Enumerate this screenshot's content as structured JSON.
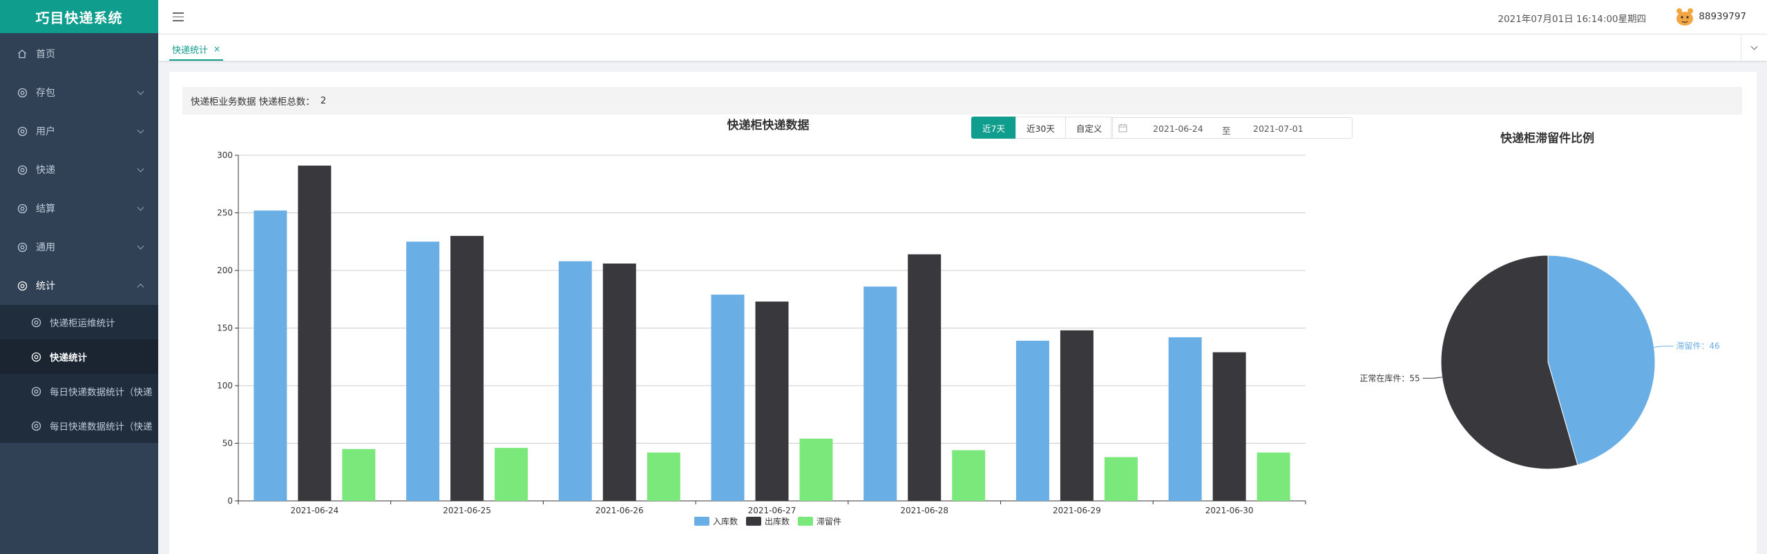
{
  "app": {
    "title": "巧目快递系统"
  },
  "sidebar": {
    "items": [
      {
        "label": "首页",
        "icon": "home-icon",
        "has_children": false
      },
      {
        "label": "存包",
        "icon": "gear-icon",
        "has_children": true
      },
      {
        "label": "用户",
        "icon": "gear-icon",
        "has_children": true
      },
      {
        "label": "快递",
        "icon": "gear-icon",
        "has_children": true
      },
      {
        "label": "结算",
        "icon": "gear-icon",
        "has_children": true
      },
      {
        "label": "通用",
        "icon": "gear-icon",
        "has_children": true
      },
      {
        "label": "统计",
        "icon": "gear-icon",
        "has_children": true,
        "open": true
      }
    ],
    "submenu": [
      {
        "label": "快递柜运维统计",
        "active": false
      },
      {
        "label": "快递统计",
        "active": true
      },
      {
        "label": "每日快递数据统计（快递",
        "active": false
      },
      {
        "label": "每日快递数据统计（快递",
        "active": false
      }
    ]
  },
  "header": {
    "datetime": "2021年07月01日 16:14:00星期四",
    "username": "88939797"
  },
  "tabs": [
    {
      "label": "快递统计",
      "close": "×"
    }
  ],
  "info": {
    "text": "快递柜业务数据 快递柜总数：",
    "count": "2"
  },
  "filters": {
    "buttons": [
      "近7天",
      "近30天",
      "自定义"
    ],
    "active_index": 0,
    "start_date": "2021-06-24",
    "separator": "至",
    "end_date": "2021-07-01"
  },
  "colors": {
    "accent": "#0f9d8e",
    "inbound": "#6aaee6",
    "outbound": "#39393d",
    "retained": "#7be87c",
    "sidebar_bg": "#304156"
  },
  "chart_data": [
    {
      "type": "bar",
      "title": "快递柜快递数据",
      "categories": [
        "2021-06-24",
        "2021-06-25",
        "2021-06-26",
        "2021-06-27",
        "2021-06-28",
        "2021-06-29",
        "2021-06-30"
      ],
      "series": [
        {
          "name": "入库数",
          "color": "#6aaee6",
          "values": [
            252,
            225,
            208,
            179,
            186,
            139,
            142
          ]
        },
        {
          "name": "出库数",
          "color": "#39393d",
          "values": [
            291,
            230,
            206,
            173,
            214,
            148,
            129
          ]
        },
        {
          "name": "滞留件",
          "color": "#7be87c",
          "values": [
            45,
            46,
            42,
            54,
            44,
            38,
            42
          ]
        }
      ],
      "yticks": [
        0,
        50,
        100,
        150,
        200,
        250,
        300
      ],
      "ylim": [
        0,
        300
      ],
      "grid": true,
      "legend": "bottom-center"
    },
    {
      "type": "pie",
      "title": "快递柜滞留件比例",
      "slices": [
        {
          "name": "滞留件",
          "label": "滞留件：46",
          "value": 46,
          "color": "#6aaee6"
        },
        {
          "name": "正常在库件",
          "label": "正常在库件：55",
          "value": 55,
          "color": "#39393d"
        }
      ]
    }
  ]
}
